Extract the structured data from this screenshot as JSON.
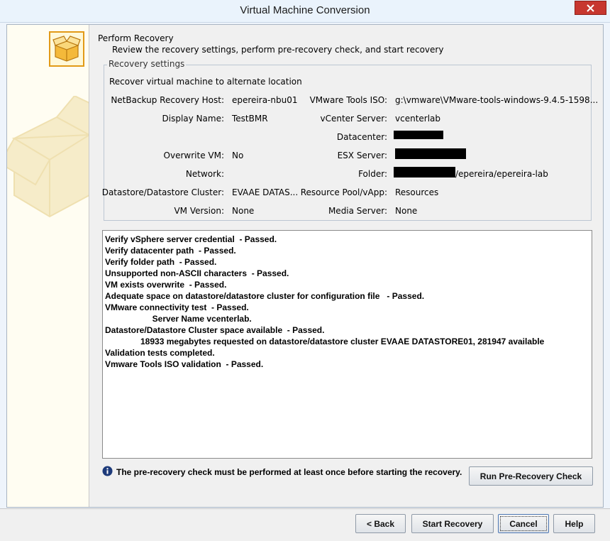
{
  "window": {
    "title": "Virtual Machine Conversion"
  },
  "header": {
    "title": "Perform Recovery",
    "subtitle": "Review the recovery settings, perform pre-recovery check, and start recovery"
  },
  "settings": {
    "legend": "Recovery settings",
    "subtitle": "Recover virtual machine to alternate location",
    "fields": {
      "netbackup_host": {
        "label": "NetBackup Recovery Host:",
        "value": "epereira-nbu01"
      },
      "display_name": {
        "label": "Display Name:",
        "value": "TestBMR"
      },
      "overwrite_vm": {
        "label": "Overwrite VM:",
        "value": "No"
      },
      "network": {
        "label": "Network:",
        "value": ""
      },
      "datastore": {
        "label": "Datastore/Datastore Cluster:",
        "value": "EVAAE DATAS..."
      },
      "vm_version": {
        "label": "VM Version:",
        "value": "None"
      },
      "vmware_tools_iso": {
        "label": "VMware Tools ISO:",
        "value": "g:\\vmware\\VMware-tools-windows-9.4.5-1598..."
      },
      "vcenter_server": {
        "label": "vCenter Server:",
        "value": "vcenterlab"
      },
      "datacenter": {
        "label": "Datacenter:",
        "value": ""
      },
      "esx_server": {
        "label": "ESX Server:",
        "value": ""
      },
      "folder": {
        "label": "Folder:",
        "value": "/epereira/epereira-lab"
      },
      "resource_pool": {
        "label": "Resource Pool/vApp:",
        "value": "Resources"
      },
      "media_server": {
        "label": "Media Server:",
        "value": "None"
      }
    }
  },
  "log_lines": [
    "Verify vSphere server credential  - Passed.",
    "Verify datacenter path  - Passed.",
    "Verify folder path  - Passed.",
    "Unsupported non-ASCII characters  - Passed.",
    "VM exists overwrite  - Passed.",
    "Adequate space on datastore/datastore cluster for configuration file   - Passed.",
    "VMware connectivity test  - Passed.",
    "                    Server Name vcenterlab.",
    "Datastore/Datastore Cluster space available  - Passed.",
    "               18933 megabytes requested on datastore/datastore cluster EVAAE DATASTORE01, 281947 available",
    "Validation tests completed.",
    "Vmware Tools ISO validation  - Passed."
  ],
  "info": {
    "text": "The pre-recovery check must be performed at least once before starting the recovery."
  },
  "buttons": {
    "run_check": "Run Pre-Recovery Check",
    "back": "< Back",
    "start": "Start Recovery",
    "cancel": "Cancel",
    "help": "Help"
  },
  "colors": {
    "close": "#c7372f",
    "wizard_icon": "#e29a17",
    "info_icon": "#1d3a7a"
  }
}
